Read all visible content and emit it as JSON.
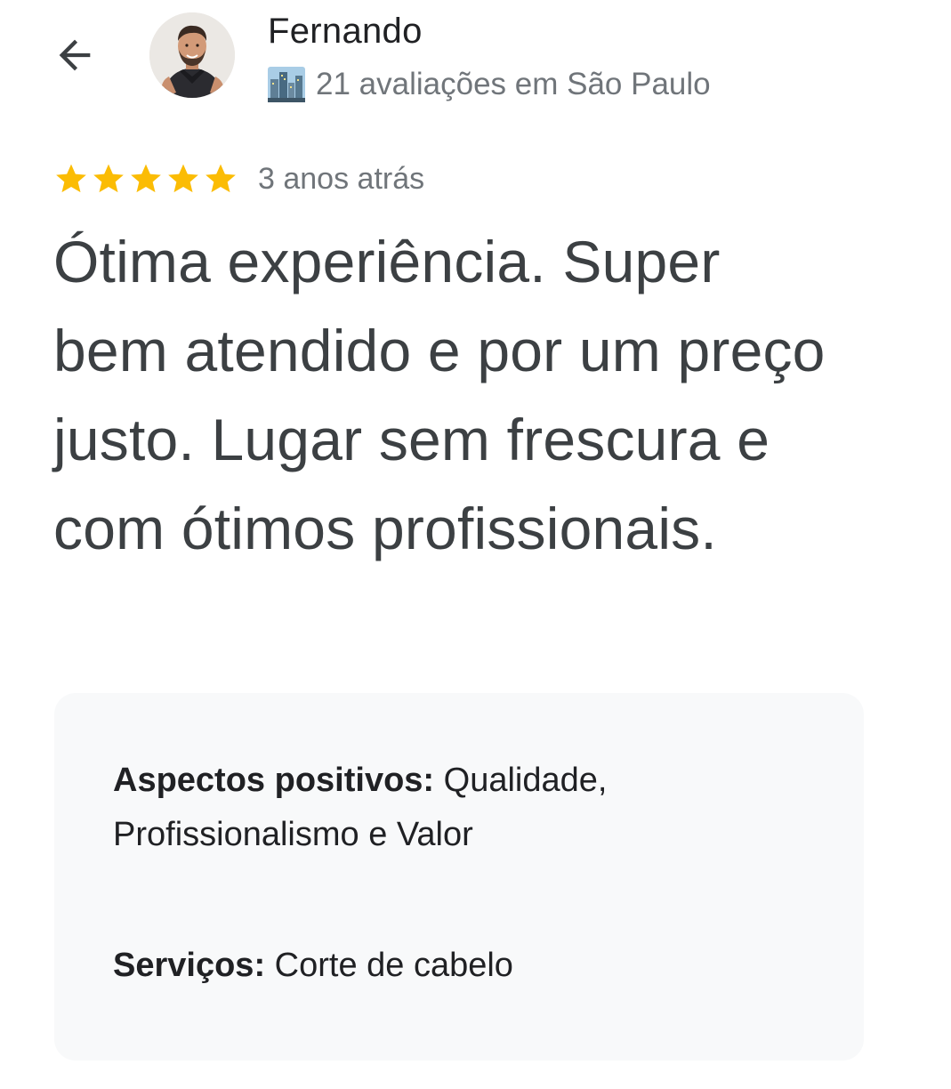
{
  "reviewer": {
    "name": "Fernando",
    "meta": "21 avaliações em São Paulo",
    "meta_icon": "city-skyline-icon"
  },
  "review": {
    "rating": 5,
    "rating_max": 5,
    "star_color": "#fbbc04",
    "time_ago": "3 anos atrás",
    "text": "Ótima experiência. Super bem atendido e por um preço justo. Lugar sem frescura e com ótimos profissionais."
  },
  "attributes": {
    "positive_label": "Aspectos positivos:",
    "positive_value": "Qualidade, Profissionalismo e Valor",
    "services_label": "Serviços:",
    "services_value": "Corte de cabelo"
  },
  "icons": {
    "back": "arrow-back-icon"
  }
}
